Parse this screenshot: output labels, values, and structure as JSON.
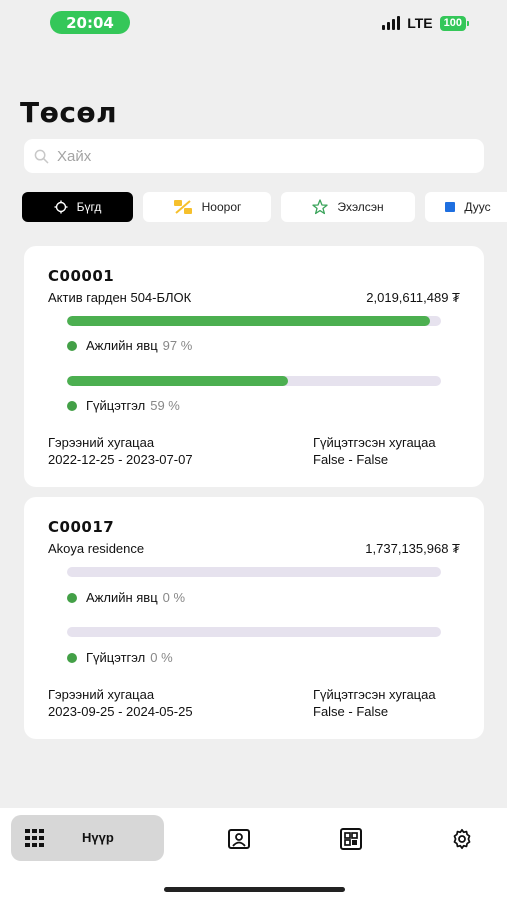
{
  "status": {
    "time": "20:04",
    "network": "LTE",
    "battery": "100"
  },
  "page_title": "Төсөл",
  "search": {
    "placeholder": "Хайх"
  },
  "filters": [
    {
      "label": "Бүгд",
      "active": true,
      "icon": "loader-icon"
    },
    {
      "label": "Ноорог",
      "active": false,
      "icon": "draft-icon"
    },
    {
      "label": "Эхэлсэн",
      "active": false,
      "icon": "star-icon"
    },
    {
      "label": "Дуус",
      "active": false,
      "icon": "square-icon"
    }
  ],
  "projects": [
    {
      "code": "C00001",
      "name": "Актив гарден 504-БЛОК",
      "amount": "2,019,611,489 ₮",
      "work_progress": {
        "label": "Ажлийн явц",
        "percent_text": "97 %",
        "value": 97
      },
      "completion": {
        "label": "Гүйцэтгэл",
        "percent_text": "59 %",
        "value": 59
      },
      "contract_period_label": "Гэрээний хугацаа",
      "contract_period": "2022-12-25 - 2023-07-07",
      "completed_period_label": "Гүйцэтгэсэн хугацаа",
      "completed_period": "False - False"
    },
    {
      "code": "C00017",
      "name": "Akoya residence",
      "amount": "1,737,135,968 ₮",
      "work_progress": {
        "label": "Ажлийн явц",
        "percent_text": "0 %",
        "value": 0
      },
      "completion": {
        "label": "Гүйцэтгэл",
        "percent_text": "0 %",
        "value": 0
      },
      "contract_period_label": "Гэрээний хугацаа",
      "contract_period": "2023-09-25 - 2024-05-25",
      "completed_period_label": "Гүйцэтгэсэн хугацаа",
      "completed_period": "False - False"
    }
  ],
  "bottom_nav": {
    "home_label": "Нүүр"
  },
  "colors": {
    "accent_green": "#4caf50",
    "track": "#e6e2ee",
    "status_green": "#34c759"
  }
}
